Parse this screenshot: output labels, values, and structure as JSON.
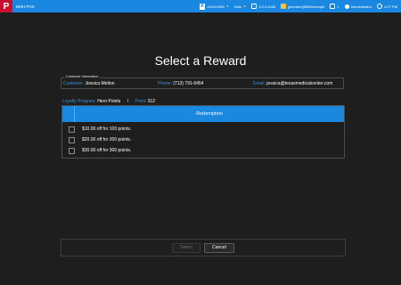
{
  "titlebar": {
    "logo": "P",
    "app_title": "BMH POS",
    "resolution": "1400x1050",
    "theme": "Dark",
    "version": "3.3.0.4466",
    "account": "jplumber@BMHsample",
    "count": "1",
    "user": "Administrator",
    "time": "4:27 PM"
  },
  "page_title": "Select a Reward",
  "customer": {
    "legend": "Customer Information",
    "name_label": "Customer:",
    "name_value": "Jessica Melton",
    "phone_label": "Phone:",
    "phone_value": "(713) 791-6454",
    "email_label": "Email:",
    "email_value": "jessica@texasmedicalcenter.com"
  },
  "loyalty": {
    "program_label": "Loyalty Program:",
    "program_value": "Hero Points",
    "separator": "/",
    "points_label": "Point:",
    "points_value": "312"
  },
  "table": {
    "header": "Redemption",
    "rows": [
      {
        "label": "$10.00 off for 100 points."
      },
      {
        "label": "$20.00 off for 200 points."
      },
      {
        "label": "$30.00 off for 300 points."
      }
    ]
  },
  "buttons": {
    "select": "Select",
    "cancel": "Cancel"
  },
  "colors": {
    "accent": "#1b88df",
    "label_blue": "#3d8fd6",
    "background": "#1e1e1e",
    "logo_red": "#c8102e"
  }
}
